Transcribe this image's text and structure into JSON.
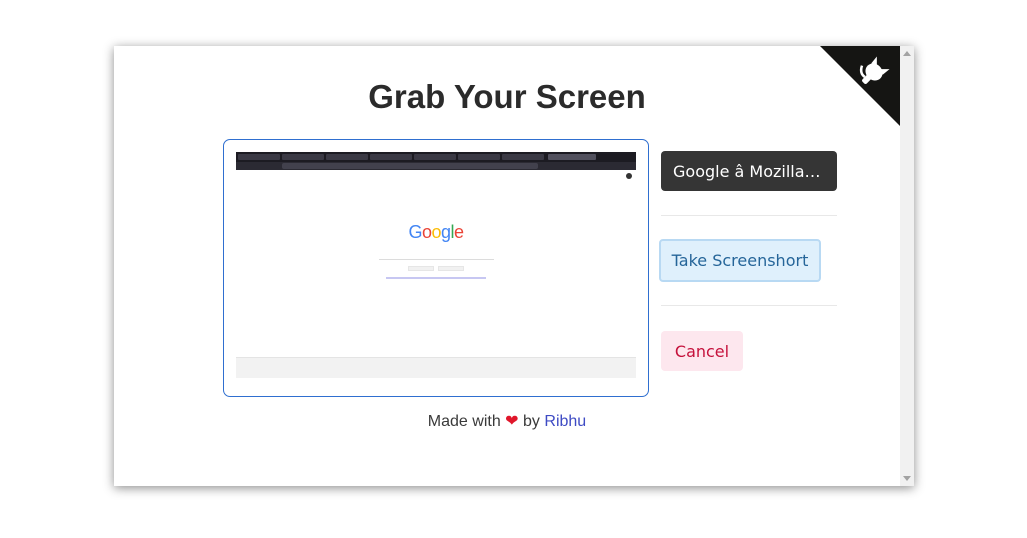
{
  "app": {
    "title": "Grab Your Screen"
  },
  "source_button": {
    "label": "Google â Mozilla F..."
  },
  "actions": {
    "take_screenshot": "Take Screenshort",
    "cancel": "Cancel"
  },
  "credits": {
    "prefix": "Made with",
    "heart": "❤",
    "middle": "by",
    "author": "Ribhu"
  },
  "preview": {
    "logo_text": "Google"
  },
  "colors": {
    "accent": "#2f6fd0",
    "source_button_bg": "#353535",
    "screenshot_bg": "#dff0fc",
    "screenshot_text": "#256599",
    "cancel_bg": "#fde7ee",
    "cancel_text": "#c5113b",
    "link": "#3e4bc4"
  },
  "icons": {
    "corner": "github-octocat-icon",
    "heart": "heart-icon"
  }
}
